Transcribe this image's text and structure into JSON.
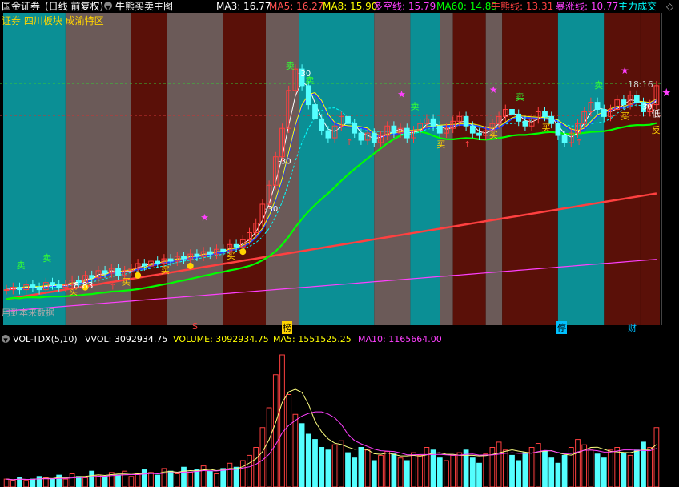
{
  "header": {
    "stock_name": "国金证券",
    "period": "(日线 前复权)",
    "indicator_name": "牛熊买卖主图",
    "ma3": "MA3: 16.77",
    "ma5": "MA5: 16.27",
    "ma8": "MA8: 15.90",
    "duokong": "多空线: 15.79",
    "ma60": "MA60: 14.89",
    "niuxiong": "牛熊线: 13.31",
    "baozhang": "暴涨线: 10.77",
    "zhuli": "主力成交"
  },
  "subtitle": "证券 四川板块 成渝特区",
  "price_labels": {
    "high_time": "18:16",
    "low_price": "8.83",
    "partial_text": "用到本来数据"
  },
  "signals": {
    "sell": "卖",
    "buy": "买",
    "neg30": "-30",
    "di": "低",
    "fan": "反",
    "yellow_strong": "强买"
  },
  "event_markers": [
    "S",
    "榜",
    "停",
    "财"
  ],
  "volume_header": {
    "indicator": "VOL-TDX(5,10)",
    "vvol": "VVOL: 3092934.75",
    "volume": "VOLUME: 3092934.75",
    "ma5": "MA5: 1551525.25",
    "ma10": "MA10: 1165664.00"
  },
  "colors": {
    "up": "#ff4040",
    "down": "#54ffff",
    "ma3": "#ffffff",
    "ma5": "#ff5050",
    "ma8": "#ffff00",
    "duokong": "#ff40ff",
    "ma60": "#00ff00",
    "niuxiong": "#ff4040",
    "baozhang": "#ff40ff",
    "zhuli": "#00ffff",
    "bg_dark": "#5a1008",
    "bg_teal": "#0b8f95",
    "bg_gray": "#6b5a58"
  },
  "chart_data": {
    "type": "candlestick",
    "price_range": [
      7.5,
      20.5
    ],
    "closes": [
      9.0,
      9.1,
      9.0,
      9.2,
      9.1,
      9.0,
      9.3,
      9.2,
      9.1,
      9.2,
      9.4,
      9.3,
      9.6,
      9.5,
      9.8,
      9.7,
      9.9,
      9.6,
      9.8,
      9.9,
      10.1,
      10.0,
      10.2,
      10.1,
      10.3,
      10.2,
      10.4,
      10.3,
      10.5,
      10.4,
      10.6,
      10.5,
      10.7,
      10.6,
      10.9,
      10.8,
      11.1,
      11.4,
      11.8,
      12.6,
      13.4,
      14.6,
      15.8,
      17.4,
      18.3,
      17.6,
      16.8,
      16.2,
      15.7,
      15.4,
      15.9,
      16.3,
      16.0,
      15.6,
      15.3,
      15.6,
      15.2,
      15.5,
      15.9,
      15.6,
      15.8,
      15.4,
      15.7,
      16.0,
      16.2,
      15.9,
      15.6,
      15.8,
      16.1,
      16.3,
      15.9,
      15.6,
      15.5,
      15.7,
      16.0,
      16.3,
      16.6,
      16.4,
      16.1,
      15.9,
      16.2,
      16.5,
      16.3,
      16.0,
      15.5,
      15.2,
      15.6,
      16.0,
      16.5,
      16.9,
      16.6,
      16.3,
      16.6,
      17.0,
      16.8,
      17.2,
      16.9,
      16.5,
      16.8,
      17.6
    ],
    "volumes": [
      6,
      5,
      7,
      5,
      6,
      8,
      7,
      6,
      9,
      6,
      10,
      8,
      7,
      12,
      9,
      8,
      11,
      9,
      12,
      8,
      10,
      13,
      11,
      9,
      14,
      12,
      10,
      15,
      11,
      13,
      16,
      12,
      10,
      14,
      18,
      15,
      20,
      24,
      30,
      45,
      60,
      85,
      100,
      70,
      55,
      48,
      40,
      36,
      30,
      28,
      32,
      35,
      26,
      22,
      30,
      28,
      20,
      24,
      27,
      25,
      22,
      20,
      26,
      24,
      30,
      28,
      22,
      20,
      24,
      26,
      28,
      22,
      18,
      25,
      30,
      34,
      28,
      24,
      20,
      26,
      30,
      33,
      27,
      22,
      18,
      24,
      30,
      36,
      32,
      28,
      25,
      22,
      28,
      30,
      26,
      24,
      28,
      34,
      30,
      45
    ]
  }
}
